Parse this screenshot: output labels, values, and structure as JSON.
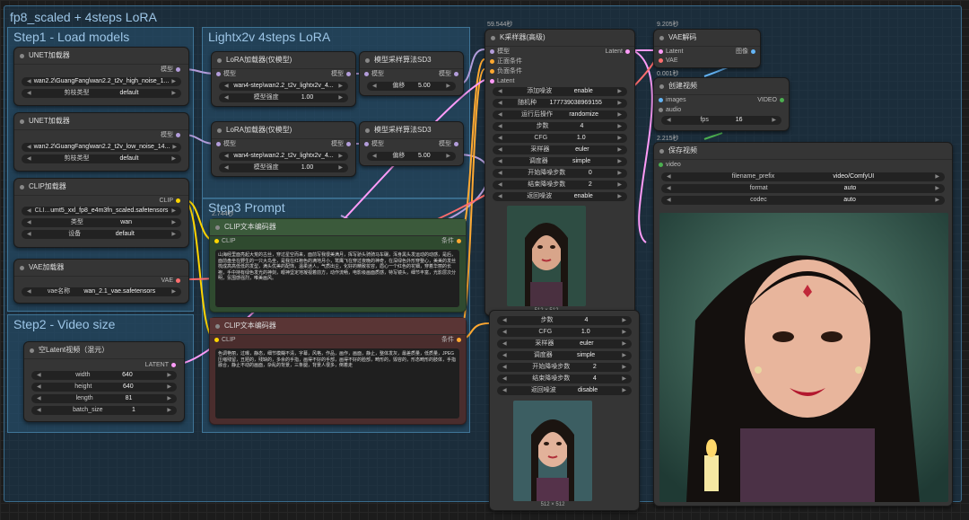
{
  "workflow_title": "fp8_scaled + 4steps LoRA",
  "groups": {
    "step1": "Step1 - Load models",
    "lightx": "Lightx2v 4steps LoRA",
    "step3": "Step3 Prompt",
    "step2": "Step2 - Video size"
  },
  "unet1": {
    "title": "UNET加载器",
    "out": "模型",
    "model": "wan2.2\\GuangFang\\wan2.2_t2v_high_noise_1...",
    "dtype_label": "剪枝类型",
    "dtype": "default"
  },
  "unet2": {
    "title": "UNET加载器",
    "out": "模型",
    "model": "wan2.2\\GuangFang\\wan2.2_t2v_low_noise_14...",
    "dtype_label": "剪枝类型",
    "dtype": "default"
  },
  "clip_loader": {
    "title": "CLIP加载器",
    "out": "CLIP",
    "name_label": "CLI...",
    "name": "umt5_xxl_fp8_e4m3fn_scaled.safetensors",
    "type_label": "类型",
    "type": "wan",
    "device_label": "设备",
    "device": "default"
  },
  "vae_loader": {
    "title": "VAE加载器",
    "out": "VAE",
    "name_label": "vae名称",
    "name": "wan_2.1_vae.safetensors"
  },
  "lora1": {
    "title": "LoRA加载器(仅模型)",
    "in": "模型",
    "out": "模型",
    "lora": "wan4-step\\wan2.2_t2v_lightx2v_4...",
    "strength_label": "模型强度",
    "strength": "1.00"
  },
  "lora2": {
    "title": "LoRA加载器(仅模型)",
    "in": "模型",
    "out": "模型",
    "lora": "wan4-step\\wan2.2_t2v_lightx2v_4...",
    "strength_label": "模型强度",
    "strength": "1.00"
  },
  "sd3_1": {
    "title": "模型采样算法SD3",
    "in": "模型",
    "out": "模型",
    "shift_label": "偏移",
    "shift": "5.00"
  },
  "sd3_2": {
    "title": "模型采样算法SD3",
    "in": "模型",
    "out": "模型",
    "shift_label": "偏移",
    "shift": "5.00"
  },
  "clip_pos": {
    "time": "2.744秒",
    "title": "CLIP文本编码器",
    "in": "CLIP",
    "out": "条件",
    "text": "山海经里面亮起大荒的古丝，穿过星空而来，面前写我很美满月，挥写骄头骑骑马车碾，浑身黑头发运动的动感，是后，面前盘坐在野生的一只大鸟坐，是我在红袍色的满地月小，鹫鹰飞在穿过夜晚的神奇，在深绿色外形穿整心，美美的发丝梳成高高低低的发型，满头优美的配饰，温柔迷人，气质出尘，化好的精致妆容，眉心一个红色的花钿，穿着华丽的长袍，手中持有绿色发光的神剑，眼神坚定地凝视着前方，动作流畅，电影级画面质感，特写镜头，细节丰富，光影层次分明，氛围感强烈，唯美画风。"
  },
  "clip_neg": {
    "title": "CLIP文本编码器",
    "in": "CLIP",
    "out": "条件",
    "text": "色调艳丽，过曝，静态，细节模糊不清，字幕，风格，作品，画作，画面，静止，整体发灰，最差质量，低质量，JPEG压缩残留，丑陋的，残缺的，多余的手指，画得不好的手部，画得不好的脸部，畸形的，毁容的，形态畸形的肢体，手指融合，静止不动的画面，杂乱的背景，三条腿，背景人很多，倒着走"
  },
  "latent": {
    "title": "空Latent视频（混元）",
    "out": "LATENT",
    "width_label": "width",
    "width": "640",
    "height_label": "height",
    "height": "640",
    "length_label": "length",
    "length": "81",
    "batch_label": "batch_size",
    "batch": "1"
  },
  "ksampler": {
    "time": "59.544秒",
    "title": "K采样器(高级)",
    "in_model": "模型",
    "in_pos": "正面条件",
    "in_neg": "负面条件",
    "in_latent": "Latent",
    "out": "Latent",
    "rows": [
      [
        "添加噪波",
        "enable"
      ],
      [
        "随机种",
        "177739038969155"
      ],
      [
        "运行后操作",
        "randomize"
      ],
      [
        "步数",
        "4"
      ],
      [
        "CFG",
        "1.0"
      ],
      [
        "采样器",
        "euler"
      ],
      [
        "调度器",
        "simple"
      ],
      [
        "开始降噪步数",
        "0"
      ],
      [
        "结束降噪步数",
        "2"
      ],
      [
        "返回噪波",
        "enable"
      ]
    ],
    "preview_caption": "512 × 512"
  },
  "ksampler2": {
    "rows": [
      [
        "步数",
        "4"
      ],
      [
        "CFG",
        "1.0"
      ],
      [
        "采样器",
        "euler"
      ],
      [
        "调度器",
        "simple"
      ],
      [
        "开始降噪步数",
        "2"
      ],
      [
        "结束降噪步数",
        "4"
      ],
      [
        "返回噪波",
        "disable"
      ]
    ],
    "preview_caption": "512 × 512"
  },
  "vae_decode": {
    "time": "9.205秒",
    "title": "VAE解码",
    "in_latent": "Latent",
    "in_vae": "VAE",
    "out": "图像"
  },
  "create_video": {
    "time": "0.001秒",
    "title": "创建视频",
    "in_images": "images",
    "in_audio": "audio",
    "out": "VIDEO",
    "fps_label": "fps",
    "fps": "16"
  },
  "save_video": {
    "time": "2.215秒",
    "title": "保存视频",
    "in_video": "video",
    "prefix_label": "filename_prefix",
    "prefix": "video/ComfyUI",
    "format_label": "format",
    "format": "auto",
    "codec_label": "codec",
    "codec": "auto"
  },
  "colors": {
    "model": "#b39ddb",
    "clip": "#ffd500",
    "conditioning": "#ffa931",
    "latent": "#ff9cf9",
    "vae": "#ff6e6e",
    "image": "#64b5f6",
    "video": "#4caf50"
  }
}
